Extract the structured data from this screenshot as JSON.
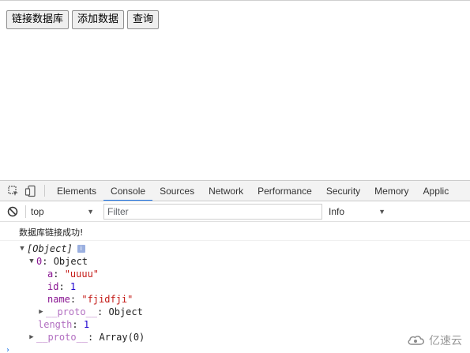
{
  "page": {
    "buttons": [
      {
        "label": "链接数据库"
      },
      {
        "label": "添加数据"
      },
      {
        "label": "查询"
      }
    ]
  },
  "devtools": {
    "tabs": [
      "Elements",
      "Console",
      "Sources",
      "Network",
      "Performance",
      "Security",
      "Memory",
      "Applic"
    ],
    "active_tab": "Console",
    "accent_color": "#1a73e8",
    "toolbar": {
      "context": "top",
      "filter_placeholder": "Filter",
      "levels": "Info"
    },
    "console": {
      "log_message": "数据库链接成功!",
      "tree": {
        "root": "[Object]",
        "item_key": "0",
        "item_type": "Object",
        "fields": [
          {
            "key": "a",
            "value": "\"uuuu\"",
            "kind": "string"
          },
          {
            "key": "id",
            "value": "1",
            "kind": "number"
          },
          {
            "key": "name",
            "value": "\"fjidfji\"",
            "kind": "string"
          }
        ],
        "item_proto_key": "__proto__",
        "item_proto_value": "Object",
        "length_key": "length",
        "length_value": "1",
        "array_proto_key": "__proto__",
        "array_proto_value": "Array(0)"
      }
    }
  },
  "watermark": {
    "text": "亿速云",
    "icon": "cloud-logo"
  }
}
